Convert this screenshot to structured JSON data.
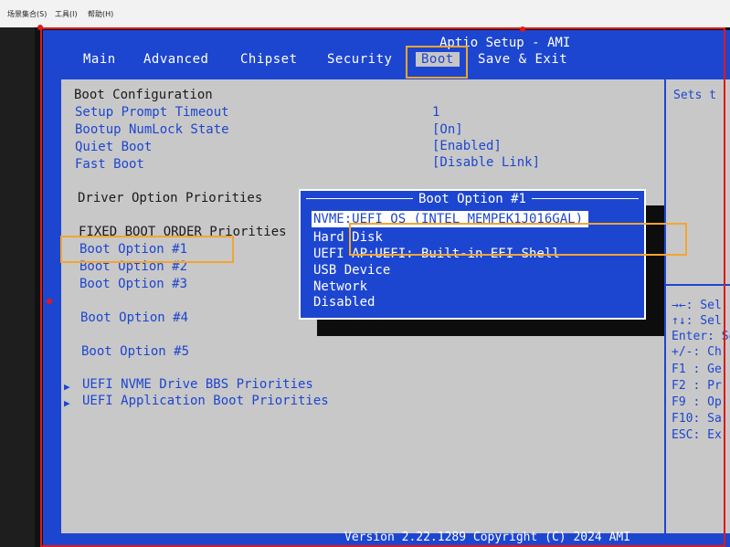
{
  "capture_toolbar": {
    "items": [
      "场景集合(S)",
      "工具(I)",
      "帮助(H)"
    ]
  },
  "bios": {
    "title": "Aptio Setup - AMI",
    "tabs": [
      "Main",
      "Advanced",
      "Chipset",
      "Security",
      "Boot",
      "Save & Exit"
    ],
    "active_tab": "Boot",
    "settings": {
      "boot_configuration": "Boot Configuration",
      "setup_prompt_timeout": {
        "label": "Setup Prompt Timeout",
        "value": "1"
      },
      "bootup_numlock_state": {
        "label": "Bootup NumLock State",
        "value": "[On]"
      },
      "quiet_boot": {
        "label": "Quiet Boot",
        "value": "[Enabled]"
      },
      "fast_boot": {
        "label": "Fast Boot",
        "value": "[Disable Link]"
      },
      "driver_option_priorities": "Driver Option Priorities",
      "fixed_boot_order": "FIXED BOOT ORDER Priorities",
      "boot_options": [
        "Boot Option #1",
        "Boot Option #2",
        "Boot Option #3",
        "Boot Option #4",
        "Boot Option #5"
      ],
      "uefi_nvme_bbs": "UEFI NVME Drive BBS Priorities",
      "uefi_app_boot": "UEFI Application Boot Priorities"
    },
    "help_panel": {
      "text": "Sets t",
      "keys": [
        "→←: Sel",
        "↑↓: Sel",
        "Enter: Se",
        "+/-: Ch",
        "F1 : Ge",
        "F2 : Pr",
        "F9 : Op",
        "F10: Sa",
        "ESC: Ex"
      ]
    },
    "popup": {
      "title": "Boot Option #1",
      "options": [
        "NVME:UEFI OS (INTEL MEMPEK1J016GAL)",
        "Hard Disk",
        "UEFI AP:UEFI: Built-in EFI Shell",
        "USB Device",
        "Network",
        "Disabled"
      ],
      "selected_index": 0
    },
    "footer": "Version 2.22.1289 Copyright (C) 2024 AMI"
  },
  "colors": {
    "bios_blue": "#1d46d0",
    "content_gray": "#c8c8c8",
    "annotation_red": "#e01818",
    "highlight_orange": "#f2a530"
  }
}
